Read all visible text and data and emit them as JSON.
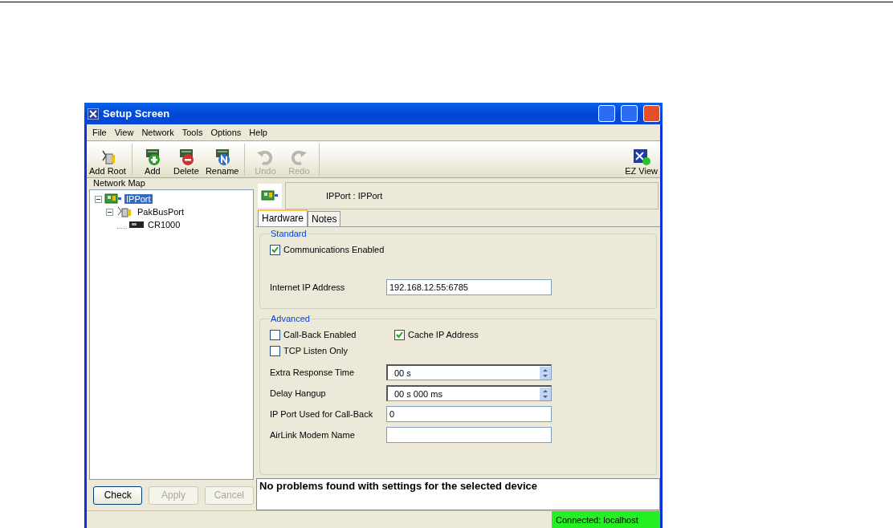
{
  "window": {
    "title": "Setup Screen"
  },
  "menu": [
    "File",
    "View",
    "Network",
    "Tools",
    "Options",
    "Help"
  ],
  "toolbar": [
    {
      "label": "Add Root",
      "kind": "addroot",
      "disabled": false
    },
    {
      "label": "Add",
      "kind": "add",
      "disabled": false
    },
    {
      "label": "Delete",
      "kind": "delete",
      "disabled": false
    },
    {
      "label": "Rename",
      "kind": "rename",
      "disabled": false
    },
    {
      "label": "Undo",
      "kind": "undo",
      "disabled": true
    },
    {
      "label": "Redo",
      "kind": "redo",
      "disabled": true
    }
  ],
  "ez_view": {
    "label": "EZ View"
  },
  "network_map": {
    "title": "Network Map",
    "tree": [
      {
        "label": "IPPort",
        "kind": "ipport",
        "selected": true,
        "expanded": true,
        "children": [
          {
            "label": "PakBusPort",
            "kind": "pakbus",
            "selected": false,
            "expanded": true,
            "children": [
              {
                "label": "CR1000",
                "kind": "logger",
                "selected": false
              }
            ]
          }
        ]
      }
    ]
  },
  "buttons": [
    {
      "label": "Check",
      "disabled": false
    },
    {
      "label": "Apply",
      "disabled": true
    },
    {
      "label": "Cancel",
      "disabled": true
    }
  ],
  "device": {
    "title": "IPPort : IPPort"
  },
  "tabs": [
    {
      "label": "Hardware",
      "selected": true
    },
    {
      "label": "Notes",
      "selected": false
    }
  ],
  "standard": {
    "title": "Standard",
    "communications_enabled": {
      "label": "Communications Enabled",
      "checked": true
    },
    "ip_address": {
      "label": "Internet IP Address",
      "value": "192.168.12.55:6785"
    }
  },
  "advanced": {
    "title": "Advanced",
    "call_back_enabled": {
      "label": "Call-Back Enabled",
      "checked": false
    },
    "cache_ip_address": {
      "label": "Cache IP Address",
      "checked": true
    },
    "tcp_listen_only": {
      "label": "TCP Listen Only",
      "checked": false
    },
    "fields": [
      {
        "label": "Extra Response Time",
        "value": "00 s",
        "kind": "spin"
      },
      {
        "label": "Delay Hangup",
        "value": "00 s 000 ms",
        "kind": "spin"
      },
      {
        "label": "IP Port Used for Call-Back",
        "value": "0",
        "kind": "text"
      },
      {
        "label": "AirLink Modem Name",
        "kind": "text"
      }
    ]
  },
  "message": "No problems found with settings for the selected device",
  "status_bar": {
    "connection": "Connected: localhost"
  }
}
